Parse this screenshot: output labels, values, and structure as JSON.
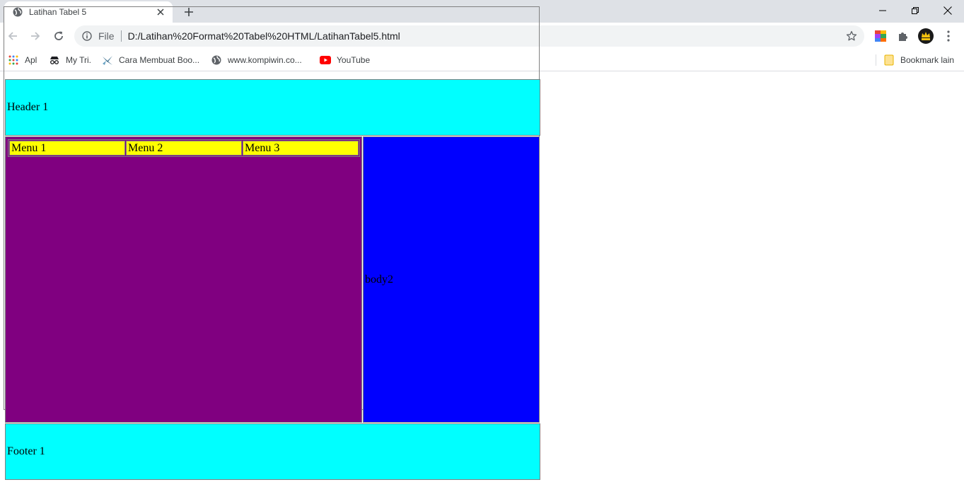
{
  "browser": {
    "tab": {
      "title": "Latihan Tabel 5"
    },
    "address": {
      "scheme": "File",
      "url": "D:/Latihan%20Format%20Tabel%20HTML/LatihanTabel5.html"
    },
    "bookmarks": [
      {
        "label": "Apl"
      },
      {
        "label": "My Tri."
      },
      {
        "label": "Cara Membuat Boo..."
      },
      {
        "label": "www.kompiwin.co..."
      },
      {
        "label": "YouTube"
      }
    ],
    "other_bookmarks": "Bookmark lain"
  },
  "page": {
    "header": "Header 1",
    "menus": [
      "Menu 1",
      "Menu 2",
      "Menu 3"
    ],
    "body2": "body2",
    "footer": "Footer 1"
  },
  "colors": {
    "header_bg": "#00ffff",
    "menu_area_bg": "#800080",
    "menu_cell_bg": "#ffff00",
    "body2_bg": "#0000ff",
    "footer_bg": "#00ffff"
  }
}
